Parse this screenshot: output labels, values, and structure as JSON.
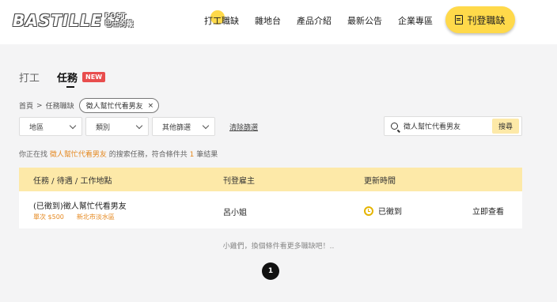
{
  "logo": {
    "main": "BASTILLE",
    "sub1": "POST",
    "sub2": "巴士的報"
  },
  "nav": {
    "items": [
      "打工職缺",
      "雜地台",
      "產品介紹",
      "最新公告",
      "企業專區"
    ]
  },
  "post_button": {
    "label": "刊登職缺"
  },
  "tabs": {
    "part_time": "打工",
    "task": "任務",
    "new_badge": "NEW"
  },
  "breadcrumb": {
    "home": "首頁",
    "sep": ">",
    "section": "任務職缺",
    "chip": "徵人幫忙代看男友",
    "chip_close": "×"
  },
  "filters": {
    "area": "地區",
    "category": "類別",
    "other": "其他篩選",
    "clear": "清除篩選"
  },
  "search": {
    "value": "徵人幫忙代看男友",
    "button": "搜尋"
  },
  "result": {
    "prefix": "你正在找",
    "keyword": "徵人幫忙代看男友",
    "middle": "的搜索任務，符合條件共",
    "count": "1",
    "suffix": "筆結果"
  },
  "table": {
    "headers": [
      "任務 / 待遇 / 工作地點",
      "刊登雇主",
      "更新時間"
    ],
    "rows": [
      {
        "title": "(已徵到)徵人幫忙代看男友",
        "pay": "單次 $500",
        "location": "新北市淡水區",
        "employer": "呂小姐",
        "status": "已徵到",
        "action": "立即查看"
      }
    ]
  },
  "more_hint": "小雞們，換個條件看更多職缺吧！..",
  "pagination": {
    "current": "1"
  }
}
